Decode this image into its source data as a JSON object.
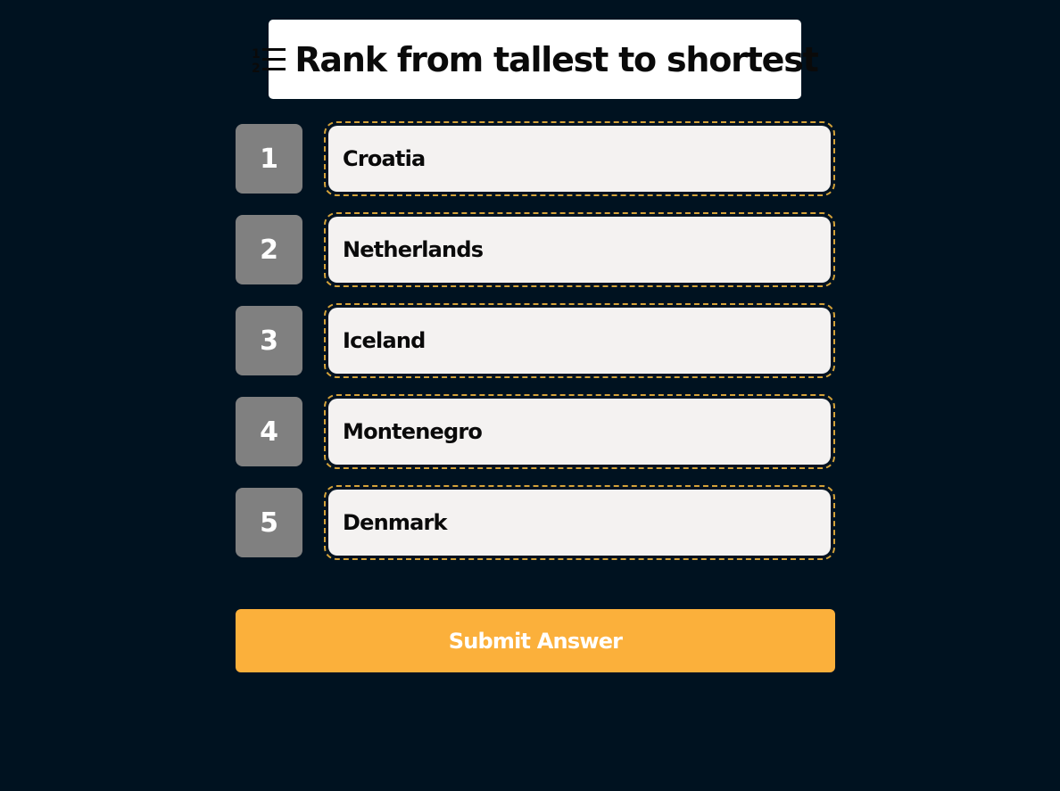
{
  "header": {
    "title": "Rank from tallest to shortest",
    "icon": "numbered-list-icon"
  },
  "items": [
    {
      "rank": "1",
      "label": "Croatia"
    },
    {
      "rank": "2",
      "label": "Netherlands"
    },
    {
      "rank": "3",
      "label": "Iceland"
    },
    {
      "rank": "4",
      "label": "Montenegro"
    },
    {
      "rank": "5",
      "label": "Denmark"
    }
  ],
  "submit": {
    "label": "Submit Answer"
  },
  "colors": {
    "background": "#001220",
    "accent": "#fbb03b",
    "rank_badge": "#808080",
    "item_border": "#d4a239"
  }
}
